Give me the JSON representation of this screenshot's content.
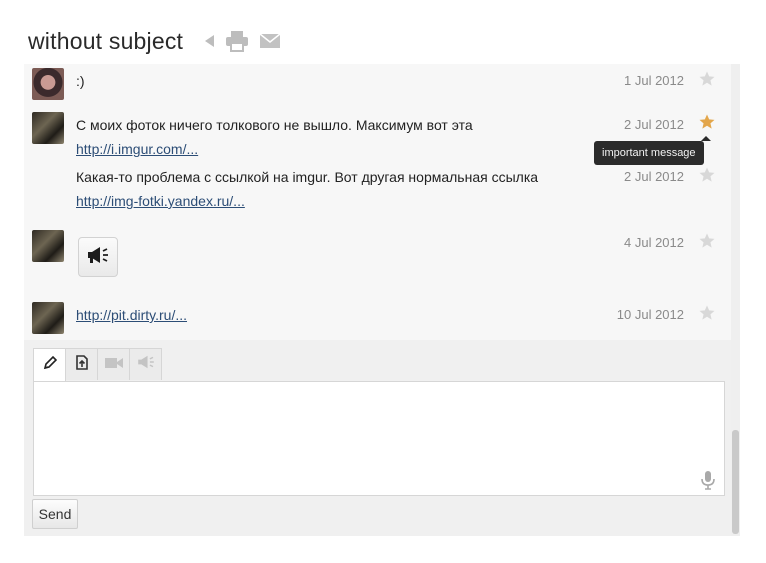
{
  "conversation": {
    "title": "without subject",
    "icons": [
      "back-arrow-icon",
      "print-icon",
      "mail-icon"
    ]
  },
  "messages": [
    {
      "text": ":)",
      "link": "",
      "date": "1 Jul 2012",
      "important": false,
      "avatar": "avatar-woman"
    },
    {
      "text": "С моих фоток ничего толкового не вышло. Максимум вот эта",
      "link": "http://i.imgur.com/...",
      "date": "2 Jul 2012",
      "important": true,
      "avatar": "avatar-man"
    },
    {
      "text": "Какая-то проблема с ссылкой на imgur. Вот другая нормальная ссылка",
      "link": "http://img-fotki.yandex.ru/...",
      "date": "2 Jul 2012",
      "important": false,
      "avatar": ""
    },
    {
      "text": "",
      "link": "",
      "attachment": "megaphone-icon",
      "date": "4 Jul 2012",
      "important": false,
      "avatar": "avatar-man"
    },
    {
      "text": "",
      "link": "http://pit.dirty.ru/...",
      "date": "10 Jul 2012",
      "important": false,
      "avatar": "avatar-man"
    }
  ],
  "tooltip": "important message",
  "composer": {
    "tabs": [
      "pencil-icon",
      "file-upload-icon",
      "video-icon",
      "megaphone-icon"
    ],
    "active_tab": 0,
    "input_value": "",
    "send_label": "Send"
  },
  "colors": {
    "star_active": "#e3a64b",
    "star_inactive": "#d8d8d8",
    "link": "#2c4d76"
  }
}
